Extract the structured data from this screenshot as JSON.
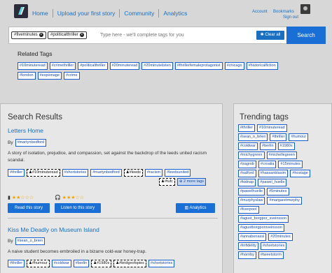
{
  "header": {
    "nav": [
      "Home",
      "Upload your first story",
      "Community",
      "Analytics"
    ],
    "account": "Account",
    "bookmarks": "Bookmarks",
    "signout": "Sign out"
  },
  "search": {
    "chips": [
      "#fiveminutes",
      "#politicalthriller"
    ],
    "placeholder": "Type here - we'll complete tags for you",
    "clear_label": "Clear all",
    "search_label": "Search"
  },
  "related": {
    "title": "Related Tags",
    "row1": [
      "#10minuteread",
      "#crimethriller",
      "#politicalthriller",
      "#20minuteread",
      "#20minutelisten",
      "#thrillerfemaleprotagonist",
      "#chicago",
      "#historicalfiction"
    ],
    "row2": [
      "#london",
      "#espionage",
      "#crime"
    ]
  },
  "results": {
    "title": "Search Results",
    "stories": [
      {
        "title": "Letters Home",
        "by_label": "By",
        "author": "#martynbedford",
        "description": "A story of isolation, prejudice, and compassion, set against the backdrop of the leeds united racism scandal.",
        "tags": [
          "#thriller",
          "#10minuteread",
          "#shortstories",
          "#martynbedford",
          "#leeds",
          "#racism",
          "#leedsunited",
          "#tufc",
          "2 more tags"
        ],
        "stars": "★★☆☆☆",
        "listen_stars": "★★★☆☆",
        "read_label": "Read this story",
        "listen_label": "Listen to this story",
        "analytics_label": "Analytics"
      },
      {
        "title": "Kiss Me Deadly on Museum Island",
        "by_label": "By",
        "author": "#sean_o_brien",
        "description": "A naive student becomes embroiled in a bizarre cold-war honey-trap.",
        "tags": [
          "#thriller",
          "#humour",
          "#coldwar",
          "#berlin",
          "#1980s",
          "#bridgeofspies",
          "#shortstories"
        ]
      }
    ]
  },
  "trending": {
    "title": "Trending tags",
    "rows": [
      [
        "#thriller",
        "#10minuteread"
      ],
      [
        "#sean_o_brien",
        "#thriller",
        "#humour"
      ],
      [
        "#coldwar",
        "#berlin",
        "#1980s"
      ],
      [
        "#michygreen",
        "#michellegreen"
      ],
      [
        "#zagrob",
        "#croatia",
        "#15minutes"
      ],
      [
        "#salford",
        "#hassanblasim",
        "#hostage"
      ],
      [
        "#kidnap",
        "#pawel_huelle"
      ],
      [
        "#pawelhuelle",
        "#5minutes"
      ],
      [
        "#murphyslaw",
        "#margaretmurphy"
      ],
      [
        "#liverpool"
      ],
      [
        "#agust_borgpor_sveinsson"
      ],
      [
        "#agustborgporsveinsson"
      ],
      [
        "#annabenassi",
        "#20minutes"
      ],
      [
        "#infidelity",
        "#shortstories"
      ],
      [
        "#hornby",
        "#tweetstorm"
      ]
    ]
  }
}
